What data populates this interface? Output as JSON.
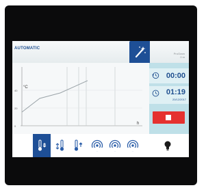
{
  "header": {
    "mode_label": "AUTOMATIC",
    "program_line1": "ProGram",
    "program_line2": "0 m"
  },
  "chart": {
    "y_unit": "°C",
    "x_unit": "h",
    "y_tick_labels": [
      "40",
      "20",
      "0"
    ]
  },
  "timers": {
    "elapsed": {
      "value": "00:00",
      "icon": "history-icon"
    },
    "clock": {
      "value": "01:19",
      "date": "20/12/2017",
      "icon": "clock-icon"
    }
  },
  "actions": {
    "stop_icon": "stop-icon",
    "stop_color": "#e5312f"
  },
  "toolbar": {
    "items": [
      {
        "icon": "temperature-down-icon",
        "active": true
      },
      {
        "icon": "temperature-updown-icon",
        "active": false
      },
      {
        "icon": "temperature-up-icon",
        "active": false
      },
      {
        "icon": "fan-icon",
        "active": false
      },
      {
        "icon": "fan-icon",
        "active": false
      },
      {
        "icon": "fan-icon",
        "active": false
      },
      {
        "icon": "lightbulb-icon",
        "active": false
      }
    ]
  },
  "colors": {
    "accent": "#1e4f96",
    "panel": "#bfe0e8",
    "bezel": "#0b0b0c"
  }
}
